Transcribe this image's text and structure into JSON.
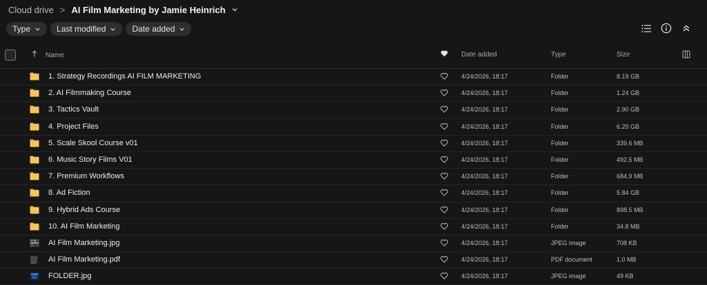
{
  "breadcrumb": {
    "root": "Cloud drive",
    "separator": ">",
    "current": "AI Film Marketing by Jamie Heinrich"
  },
  "filters": [
    {
      "label": "Type"
    },
    {
      "label": "Last modified"
    },
    {
      "label": "Date added"
    }
  ],
  "toolbar": {
    "icons": [
      "list-view-icon",
      "info-icon",
      "collapse-icon"
    ]
  },
  "columns": {
    "name": "Name",
    "date_added": "Date added",
    "type": "Type",
    "size": "Size"
  },
  "colors": {
    "background": "#161616",
    "folder": "#f5b94a",
    "chip": "#2e2e2e"
  },
  "rows": [
    {
      "name": "1. Strategy Recordings AI FILM MARKETING",
      "date": "4/24/2026, 18:17",
      "type": "Folder",
      "size": "8.19 GB",
      "icon": "folder"
    },
    {
      "name": "2. AI Filmmaking Course",
      "date": "4/24/2026, 18:17",
      "type": "Folder",
      "size": "1.24 GB",
      "icon": "folder"
    },
    {
      "name": "3. Tactics Vault",
      "date": "4/24/2026, 18:17",
      "type": "Folder",
      "size": "2.90 GB",
      "icon": "folder"
    },
    {
      "name": "4. Project Files",
      "date": "4/24/2026, 18:17",
      "type": "Folder",
      "size": "6.20 GB",
      "icon": "folder"
    },
    {
      "name": "5. Scale Skool Course v01",
      "date": "4/24/2026, 18:17",
      "type": "Folder",
      "size": "339.6 MB",
      "icon": "folder"
    },
    {
      "name": "6. Music Story Films V01",
      "date": "4/24/2026, 18:17",
      "type": "Folder",
      "size": "492.5 MB",
      "icon": "folder"
    },
    {
      "name": "7. Premium Workflows",
      "date": "4/24/2026, 18:17",
      "type": "Folder",
      "size": "684.9 MB",
      "icon": "folder"
    },
    {
      "name": "8. Ad Fiction",
      "date": "4/24/2026, 18:17",
      "type": "Folder",
      "size": "5.84 GB",
      "icon": "folder"
    },
    {
      "name": "9. Hybrid Ads Course",
      "date": "4/24/2026, 18:17",
      "type": "Folder",
      "size": "898.5 MB",
      "icon": "folder"
    },
    {
      "name": "10. AI Film Marketing",
      "date": "4/24/2026, 18:17",
      "type": "Folder",
      "size": "34.8 MB",
      "icon": "folder"
    },
    {
      "name": "AI Film Marketing.jpg",
      "date": "4/24/2026, 18:17",
      "type": "JPEG image",
      "size": "708 KB",
      "icon": "image-thumbnail"
    },
    {
      "name": "AI Film Marketing.pdf",
      "date": "4/24/2026, 18:17",
      "type": "PDF document",
      "size": "1.0 MB",
      "icon": "pdf-thumbnail"
    },
    {
      "name": "FOLDER.jpg",
      "date": "4/24/2026, 18:17",
      "type": "JPEG image",
      "size": "49 KB",
      "icon": "image-thumbnail-blue"
    }
  ]
}
